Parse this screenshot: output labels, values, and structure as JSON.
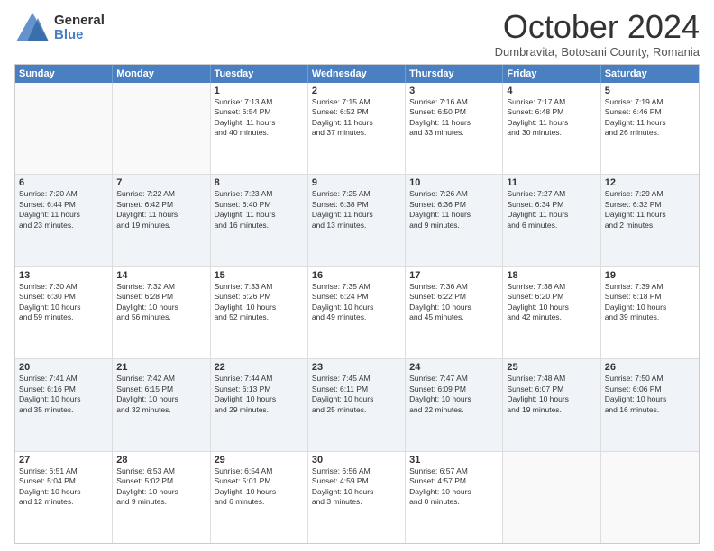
{
  "header": {
    "logo_general": "General",
    "logo_blue": "Blue",
    "month_title": "October 2024",
    "subtitle": "Dumbravita, Botosani County, Romania"
  },
  "weekdays": [
    "Sunday",
    "Monday",
    "Tuesday",
    "Wednesday",
    "Thursday",
    "Friday",
    "Saturday"
  ],
  "rows": [
    [
      {
        "day": "",
        "lines": [],
        "empty": true
      },
      {
        "day": "",
        "lines": [],
        "empty": true
      },
      {
        "day": "1",
        "lines": [
          "Sunrise: 7:13 AM",
          "Sunset: 6:54 PM",
          "Daylight: 11 hours",
          "and 40 minutes."
        ],
        "empty": false
      },
      {
        "day": "2",
        "lines": [
          "Sunrise: 7:15 AM",
          "Sunset: 6:52 PM",
          "Daylight: 11 hours",
          "and 37 minutes."
        ],
        "empty": false
      },
      {
        "day": "3",
        "lines": [
          "Sunrise: 7:16 AM",
          "Sunset: 6:50 PM",
          "Daylight: 11 hours",
          "and 33 minutes."
        ],
        "empty": false
      },
      {
        "day": "4",
        "lines": [
          "Sunrise: 7:17 AM",
          "Sunset: 6:48 PM",
          "Daylight: 11 hours",
          "and 30 minutes."
        ],
        "empty": false
      },
      {
        "day": "5",
        "lines": [
          "Sunrise: 7:19 AM",
          "Sunset: 6:46 PM",
          "Daylight: 11 hours",
          "and 26 minutes."
        ],
        "empty": false
      }
    ],
    [
      {
        "day": "6",
        "lines": [
          "Sunrise: 7:20 AM",
          "Sunset: 6:44 PM",
          "Daylight: 11 hours",
          "and 23 minutes."
        ],
        "empty": false
      },
      {
        "day": "7",
        "lines": [
          "Sunrise: 7:22 AM",
          "Sunset: 6:42 PM",
          "Daylight: 11 hours",
          "and 19 minutes."
        ],
        "empty": false
      },
      {
        "day": "8",
        "lines": [
          "Sunrise: 7:23 AM",
          "Sunset: 6:40 PM",
          "Daylight: 11 hours",
          "and 16 minutes."
        ],
        "empty": false
      },
      {
        "day": "9",
        "lines": [
          "Sunrise: 7:25 AM",
          "Sunset: 6:38 PM",
          "Daylight: 11 hours",
          "and 13 minutes."
        ],
        "empty": false
      },
      {
        "day": "10",
        "lines": [
          "Sunrise: 7:26 AM",
          "Sunset: 6:36 PM",
          "Daylight: 11 hours",
          "and 9 minutes."
        ],
        "empty": false
      },
      {
        "day": "11",
        "lines": [
          "Sunrise: 7:27 AM",
          "Sunset: 6:34 PM",
          "Daylight: 11 hours",
          "and 6 minutes."
        ],
        "empty": false
      },
      {
        "day": "12",
        "lines": [
          "Sunrise: 7:29 AM",
          "Sunset: 6:32 PM",
          "Daylight: 11 hours",
          "and 2 minutes."
        ],
        "empty": false
      }
    ],
    [
      {
        "day": "13",
        "lines": [
          "Sunrise: 7:30 AM",
          "Sunset: 6:30 PM",
          "Daylight: 10 hours",
          "and 59 minutes."
        ],
        "empty": false
      },
      {
        "day": "14",
        "lines": [
          "Sunrise: 7:32 AM",
          "Sunset: 6:28 PM",
          "Daylight: 10 hours",
          "and 56 minutes."
        ],
        "empty": false
      },
      {
        "day": "15",
        "lines": [
          "Sunrise: 7:33 AM",
          "Sunset: 6:26 PM",
          "Daylight: 10 hours",
          "and 52 minutes."
        ],
        "empty": false
      },
      {
        "day": "16",
        "lines": [
          "Sunrise: 7:35 AM",
          "Sunset: 6:24 PM",
          "Daylight: 10 hours",
          "and 49 minutes."
        ],
        "empty": false
      },
      {
        "day": "17",
        "lines": [
          "Sunrise: 7:36 AM",
          "Sunset: 6:22 PM",
          "Daylight: 10 hours",
          "and 45 minutes."
        ],
        "empty": false
      },
      {
        "day": "18",
        "lines": [
          "Sunrise: 7:38 AM",
          "Sunset: 6:20 PM",
          "Daylight: 10 hours",
          "and 42 minutes."
        ],
        "empty": false
      },
      {
        "day": "19",
        "lines": [
          "Sunrise: 7:39 AM",
          "Sunset: 6:18 PM",
          "Daylight: 10 hours",
          "and 39 minutes."
        ],
        "empty": false
      }
    ],
    [
      {
        "day": "20",
        "lines": [
          "Sunrise: 7:41 AM",
          "Sunset: 6:16 PM",
          "Daylight: 10 hours",
          "and 35 minutes."
        ],
        "empty": false
      },
      {
        "day": "21",
        "lines": [
          "Sunrise: 7:42 AM",
          "Sunset: 6:15 PM",
          "Daylight: 10 hours",
          "and 32 minutes."
        ],
        "empty": false
      },
      {
        "day": "22",
        "lines": [
          "Sunrise: 7:44 AM",
          "Sunset: 6:13 PM",
          "Daylight: 10 hours",
          "and 29 minutes."
        ],
        "empty": false
      },
      {
        "day": "23",
        "lines": [
          "Sunrise: 7:45 AM",
          "Sunset: 6:11 PM",
          "Daylight: 10 hours",
          "and 25 minutes."
        ],
        "empty": false
      },
      {
        "day": "24",
        "lines": [
          "Sunrise: 7:47 AM",
          "Sunset: 6:09 PM",
          "Daylight: 10 hours",
          "and 22 minutes."
        ],
        "empty": false
      },
      {
        "day": "25",
        "lines": [
          "Sunrise: 7:48 AM",
          "Sunset: 6:07 PM",
          "Daylight: 10 hours",
          "and 19 minutes."
        ],
        "empty": false
      },
      {
        "day": "26",
        "lines": [
          "Sunrise: 7:50 AM",
          "Sunset: 6:06 PM",
          "Daylight: 10 hours",
          "and 16 minutes."
        ],
        "empty": false
      }
    ],
    [
      {
        "day": "27",
        "lines": [
          "Sunrise: 6:51 AM",
          "Sunset: 5:04 PM",
          "Daylight: 10 hours",
          "and 12 minutes."
        ],
        "empty": false
      },
      {
        "day": "28",
        "lines": [
          "Sunrise: 6:53 AM",
          "Sunset: 5:02 PM",
          "Daylight: 10 hours",
          "and 9 minutes."
        ],
        "empty": false
      },
      {
        "day": "29",
        "lines": [
          "Sunrise: 6:54 AM",
          "Sunset: 5:01 PM",
          "Daylight: 10 hours",
          "and 6 minutes."
        ],
        "empty": false
      },
      {
        "day": "30",
        "lines": [
          "Sunrise: 6:56 AM",
          "Sunset: 4:59 PM",
          "Daylight: 10 hours",
          "and 3 minutes."
        ],
        "empty": false
      },
      {
        "day": "31",
        "lines": [
          "Sunrise: 6:57 AM",
          "Sunset: 4:57 PM",
          "Daylight: 10 hours",
          "and 0 minutes."
        ],
        "empty": false
      },
      {
        "day": "",
        "lines": [],
        "empty": true
      },
      {
        "day": "",
        "lines": [],
        "empty": true
      }
    ]
  ]
}
